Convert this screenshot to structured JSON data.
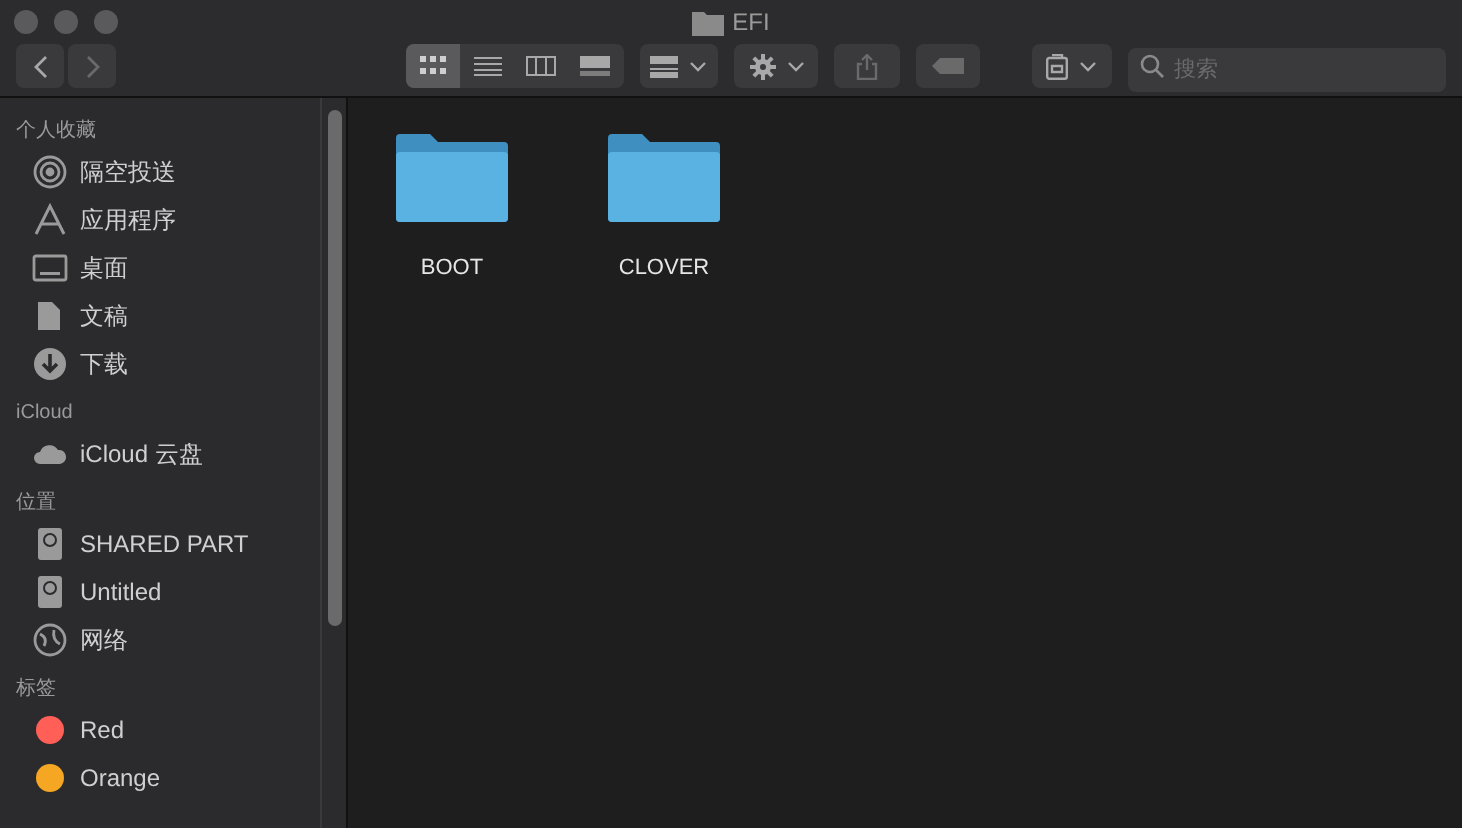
{
  "window": {
    "title": "EFI"
  },
  "toolbar": {
    "view_modes": [
      {
        "kind": "icons",
        "selected": true
      },
      {
        "kind": "list",
        "selected": false
      },
      {
        "kind": "columns",
        "selected": false
      },
      {
        "kind": "gallery",
        "selected": false
      }
    ],
    "search": {
      "placeholder": "搜索"
    }
  },
  "sidebar": {
    "sections": [
      {
        "title": "个人收藏",
        "items": [
          {
            "label": "隔空投送",
            "kind": "airdrop"
          },
          {
            "label": "应用程序",
            "kind": "apps"
          },
          {
            "label": "桌面",
            "kind": "desktop"
          },
          {
            "label": "文稿",
            "kind": "documents"
          },
          {
            "label": "下载",
            "kind": "downloads"
          }
        ]
      },
      {
        "title": "iCloud",
        "items": [
          {
            "label": "iCloud 云盘",
            "kind": "cloud"
          }
        ]
      },
      {
        "title": "位置",
        "items": [
          {
            "label": "SHARED PART",
            "kind": "disk"
          },
          {
            "label": "Untitled",
            "kind": "disk"
          },
          {
            "label": "网络",
            "kind": "network"
          }
        ]
      },
      {
        "title": "标签",
        "items": [
          {
            "label": "Red",
            "kind": "tag",
            "color": "#ff5f57"
          },
          {
            "label": "Orange",
            "kind": "tag",
            "color": "#f5a623"
          }
        ]
      }
    ]
  },
  "files": [
    {
      "name": "BOOT"
    },
    {
      "name": "CLOVER"
    }
  ]
}
